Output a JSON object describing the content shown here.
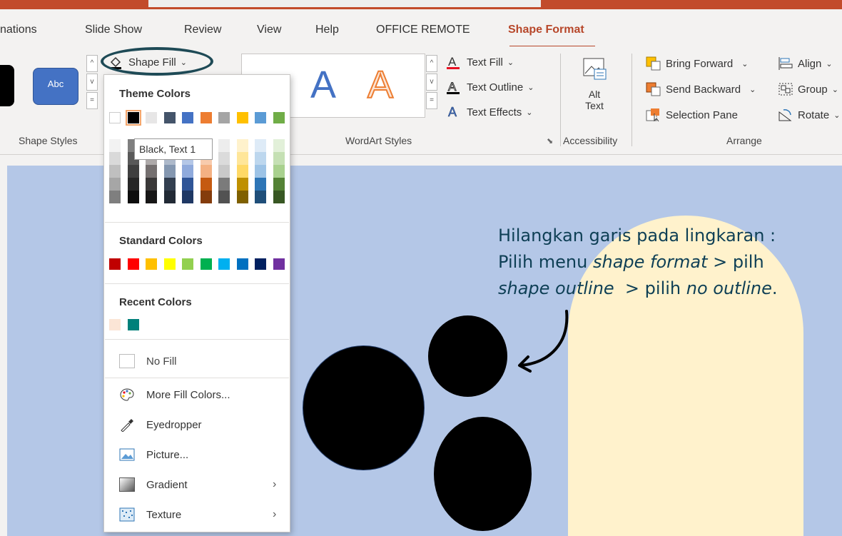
{
  "tabs": [
    "nations",
    "Slide Show",
    "Review",
    "View",
    "Help",
    "OFFICE REMOTE",
    "Shape Format"
  ],
  "ribbon": {
    "shape_styles": {
      "sample_label": "Abc",
      "group_label": "Shape Styles"
    },
    "shape_fill_label": "Shape Fill",
    "wordart": {
      "text_fill": "Text Fill",
      "text_outline": "Text Outline",
      "text_effects": "Text Effects",
      "group_label": "WordArt Styles",
      "sample_letter": "A"
    },
    "accessibility": {
      "alt_text_1": "Alt",
      "alt_text_2": "Text",
      "group_label": "Accessibility"
    },
    "arrange": {
      "bring_forward": "Bring Forward",
      "send_backward": "Send Backward",
      "selection_pane": "Selection Pane",
      "align": "Align",
      "group": "Group",
      "rotate": "Rotate",
      "group_label": "Arrange"
    }
  },
  "dropdown": {
    "theme_colors_heading": "Theme Colors",
    "standard_colors_heading": "Standard Colors",
    "recent_colors_heading": "Recent Colors",
    "tooltip": "Black, Text 1",
    "theme_top_row": [
      "#ffffff",
      "#000000",
      "#e7e6e6",
      "#44546a",
      "#4472c4",
      "#ed7d31",
      "#a5a5a5",
      "#ffc000",
      "#5b9bd5",
      "#70ad47"
    ],
    "theme_shades": [
      [
        "#f2f2f2",
        "#d9d9d9",
        "#bfbfbf",
        "#a6a6a6",
        "#7f7f7f"
      ],
      [
        "#7f7f7f",
        "#595959",
        "#3f3f3f",
        "#262626",
        "#0d0d0d"
      ],
      [
        "#d0cece",
        "#aeaaaa",
        "#757070",
        "#3a3838",
        "#171616"
      ],
      [
        "#d6dce5",
        "#adb9ca",
        "#8497b0",
        "#333f50",
        "#222a35"
      ],
      [
        "#d9e2f3",
        "#b4c7e7",
        "#8faadc",
        "#2f5597",
        "#1f3864"
      ],
      [
        "#fbe5d6",
        "#f8cbad",
        "#f4b183",
        "#c55a11",
        "#843c0c"
      ],
      [
        "#ededed",
        "#dbdbdb",
        "#c9c9c9",
        "#7b7b7b",
        "#525252"
      ],
      [
        "#fff2cc",
        "#ffe699",
        "#ffd966",
        "#bf9000",
        "#7f6000"
      ],
      [
        "#deebf7",
        "#bdd7ee",
        "#9dc3e6",
        "#2e75b6",
        "#1f4e79"
      ],
      [
        "#e2f0d9",
        "#c5e0b4",
        "#a9d18e",
        "#548235",
        "#385723"
      ]
    ],
    "standard_colors": [
      "#c00000",
      "#ff0000",
      "#ffc000",
      "#ffff00",
      "#92d050",
      "#00b050",
      "#00b0f0",
      "#0070c0",
      "#002060",
      "#7030a0"
    ],
    "recent_colors": [
      "#fbe5d6",
      "#00807a"
    ],
    "items": {
      "no_fill": "No Fill",
      "more_fill_colors": "More Fill Colors...",
      "eyedropper": "Eyedropper",
      "picture": "Picture...",
      "gradient": "Gradient",
      "texture": "Texture"
    }
  },
  "annotation": {
    "line1": "Hilangkan garis pada lingkaran :",
    "line2_pre": "Pilih menu ",
    "line2_em": "shape format",
    "line2_post": " > pilh",
    "line3_em": "shape outline",
    "line3_mid": "  > pilih ",
    "line3_em2": "no outline",
    "line3_end": "."
  },
  "colors": {
    "accent": "#b7472a",
    "slide_bg": "#b4c7e7",
    "pill": "#fff2cc",
    "annotation_text": "#0e3f55"
  }
}
